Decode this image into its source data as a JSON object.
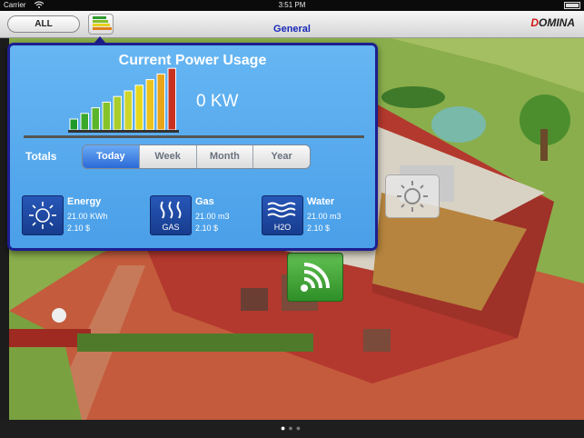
{
  "status_bar": {
    "carrier": "Carrier",
    "time": "3:51 PM"
  },
  "nav": {
    "all_label": "ALL",
    "title": "General",
    "logo": "DOMINA"
  },
  "panel": {
    "title": "Current Power Usage",
    "kw_value": "0 KW",
    "meter_level": 1.0,
    "totals_label": "Totals",
    "tabs": [
      "Today",
      "Week",
      "Month",
      "Year"
    ],
    "selected_tab": "Today",
    "stats": [
      {
        "name": "Energy",
        "value1": "21.00 KWh",
        "value2": "2.10 $",
        "icon": "sun-icon"
      },
      {
        "name": "Gas",
        "value1": "21.00 m3",
        "value2": "2.10 $",
        "icon": "gas-flame-icon",
        "icon_text": "GAS"
      },
      {
        "name": "Water",
        "value1": "21.00 m3",
        "value2": "2.10 $",
        "icon": "water-waves-icon",
        "icon_text": "H2O"
      }
    ]
  },
  "pager": {
    "count": 3,
    "active": 0
  },
  "colors": {
    "panel_bg": "#4a9fe8",
    "panel_border": "#1d1e8f",
    "accent_blue": "#2a6ad6",
    "nav_title": "#1a2ab8",
    "wifi_button": "#3ea334"
  }
}
